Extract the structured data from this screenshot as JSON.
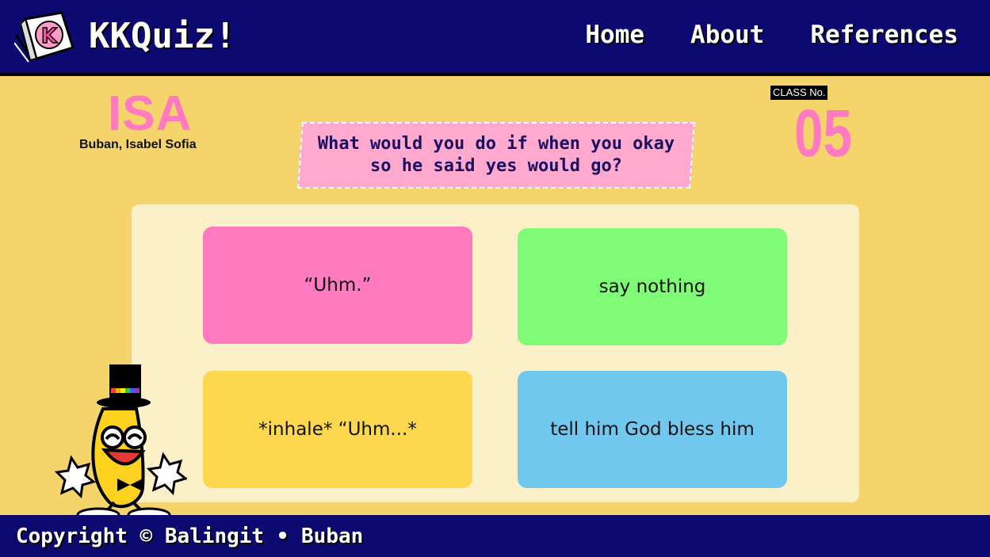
{
  "header": {
    "logo_icon": "k-letter-cube-logo",
    "brand": "KKQuiz!",
    "nav": [
      {
        "label": "Home"
      },
      {
        "label": "About"
      },
      {
        "label": "References"
      }
    ],
    "bg_color": "#0c0a70"
  },
  "student": {
    "nickname": "ISA",
    "full_name": "Buban, Isabel Sofia"
  },
  "class": {
    "label": "CLASS No.",
    "number": "05"
  },
  "question": {
    "text": "What would you do if when you okay so he said yes would go?"
  },
  "answers": [
    {
      "text": "“Uhm.”",
      "color": "#ff7ac0"
    },
    {
      "text": "say nothing",
      "color": "#80fb75"
    },
    {
      "text": "*inhale* “Uhm...*",
      "color": "#fdd84e"
    },
    {
      "text": "tell him God bless him",
      "color": "#70c8ee"
    }
  ],
  "mascot": {
    "icon": "banana-top-hat-mascot-icon"
  },
  "footer": {
    "copyright": "Copyright © Balingit • Buban"
  },
  "colors": {
    "background": "#f5d56b",
    "accent_pink": "#ff7ac0",
    "navy": "#0c0a70"
  }
}
